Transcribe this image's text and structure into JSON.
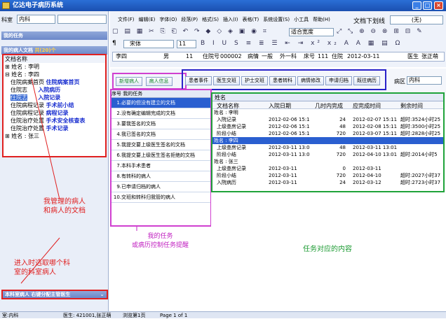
{
  "app": {
    "title": "亿达电子病历系统"
  },
  "left": {
    "dept_label": "科室",
    "dept_value": "内科",
    "my_tasks": "我的任务",
    "patients_header": "我的病人文档",
    "patients_count": "共(20)个",
    "col_doc_name": "文档名称",
    "patients": [
      "姓名 : 李明",
      "姓名 : 李四",
      "姓名 : 张三"
    ],
    "docs": [
      "住院病案首页",
      "住院志",
      "住院志",
      "住院病程记录",
      "住院病程记录",
      "住院治疗处置",
      "住院治疗处置"
    ],
    "doc_links": [
      "住院病案首页",
      "入院病历",
      "入院记录",
      "手术前小结",
      "病程记录",
      "手术安全核查表",
      "手术记录"
    ],
    "bottom_panel": "本科室病人 右键分配主管医生"
  },
  "annotations": {
    "patients_docs": "我管理的病人\n和病人的文档",
    "dept_select": "进入时选取哪个科\n室的科室病人",
    "tasks": "我的任务\n或病历控制任务提醒",
    "content": "任务对应的内容"
  },
  "toolbar": {
    "menu": [
      "文件(F)",
      "编辑(E)",
      "字体(O)",
      "段落(P)",
      "格式(S)",
      "插入(I)",
      "表格(T)",
      "系统设置(S)",
      "小工具",
      "帮助(H)"
    ],
    "doc_line_label": "文档下划线",
    "doc_line_value": "(无)",
    "zoom": "适合宽度",
    "font": "宋体",
    "font_size": "11"
  },
  "patient_bar": {
    "name": "李四",
    "sex": "男",
    "age": "11",
    "admit_label": "住院号",
    "admit_no": "000002",
    "condition_label": "病情",
    "condition": "一般",
    "dept": "外一科",
    "bed_label": "床号",
    "bed": "111",
    "date_label": "住院",
    "date": "2012-03-11",
    "doctor_label": "医生",
    "doctor": "张正萌"
  },
  "tabs": {
    "left": [
      "新增病人",
      "病人信息"
    ],
    "middle": [
      "患者事件",
      "医生交班",
      "护士交班",
      "患者转科",
      "病情修改",
      "申请归档",
      "既往病历"
    ],
    "ward_label": "病区",
    "ward": "内科"
  },
  "tasks": {
    "col_no": "序号",
    "col_task": "我的任务",
    "items": [
      "必要的但没有建立的文档",
      "没有确定编辑完成的文档",
      "要我签名的文档",
      "我已签名的文档",
      "我提交要上级医生签名的文档",
      "我提交要上级医生签名拒绝的文档",
      "本科手术患者",
      "有转科的病人",
      "已申请归档的病人",
      "交班和转科归我管的病人"
    ]
  },
  "content": {
    "group_label": "姓名",
    "cols": [
      "文档名称",
      "入院日期",
      "几时内完成",
      "应完成时间",
      "剩余时间"
    ],
    "groups": [
      {
        "name": "姓名 : 李明",
        "rows": [
          [
            "入院记录",
            "2012-02-06 15:1",
            "24",
            "2012-02-07 15:11",
            "超时:3524小时25"
          ],
          [
            "上级查房记录",
            "2012-02-06 15:1",
            "48",
            "2012-02-08 15:11",
            "超时:3500小时25"
          ],
          [
            "阶段小结",
            "2012-02-06 15:1",
            "720",
            "2012-03-07 15:11",
            "超时:2828小时25"
          ]
        ]
      },
      {
        "name": "姓名 : 李四",
        "rows": [
          [
            "上级查房记录",
            "2012-03-11 13:0",
            "48",
            "2012-03-11 13:01",
            ""
          ],
          [
            "阶段小结",
            "2012-03-11 13:0",
            "720",
            "2012-04-10 13:01",
            "超时:2014小时5"
          ]
        ]
      },
      {
        "name": "姓名 : 张三",
        "rows": [
          [
            "上级查房记录",
            "2012-03-11",
            "0",
            "2012-03-11",
            ""
          ],
          [
            "阶段小结",
            "2012-03-11",
            "720",
            "2012-04-10",
            "超时:2027小时37"
          ],
          [
            "入院病历",
            "2012-03-11",
            "24",
            "2012-03-12",
            "超时:2723小时37"
          ]
        ]
      }
    ]
  },
  "status": {
    "dept": "室:内科",
    "doctor": "医生: 421001,张正萌",
    "view": "浏览第1页",
    "page": "Page 1 of 1"
  }
}
